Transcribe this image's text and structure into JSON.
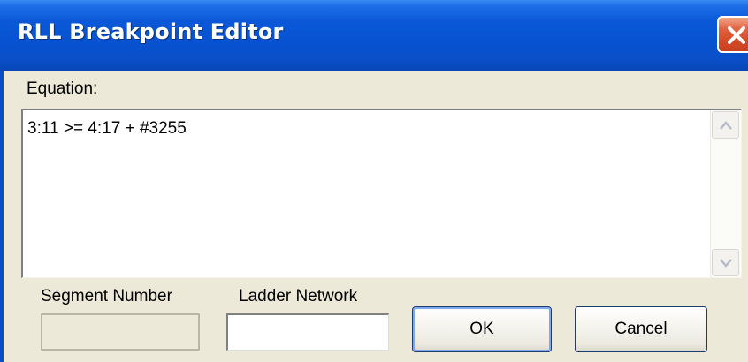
{
  "window": {
    "title": "RLL Breakpoint Editor",
    "close_icon": "close-icon"
  },
  "equation": {
    "label": "Equation:",
    "value": "3:11 >= 4:17 + #3255"
  },
  "segment": {
    "label": "Segment Number",
    "value": ""
  },
  "ladder": {
    "label": "Ladder Network",
    "value": ""
  },
  "buttons": {
    "ok_label": "OK",
    "cancel_label": "Cancel"
  },
  "colors": {
    "titlebar": "#0752d1",
    "close": "#d44a28",
    "dialog_bg": "#ece9d8"
  }
}
